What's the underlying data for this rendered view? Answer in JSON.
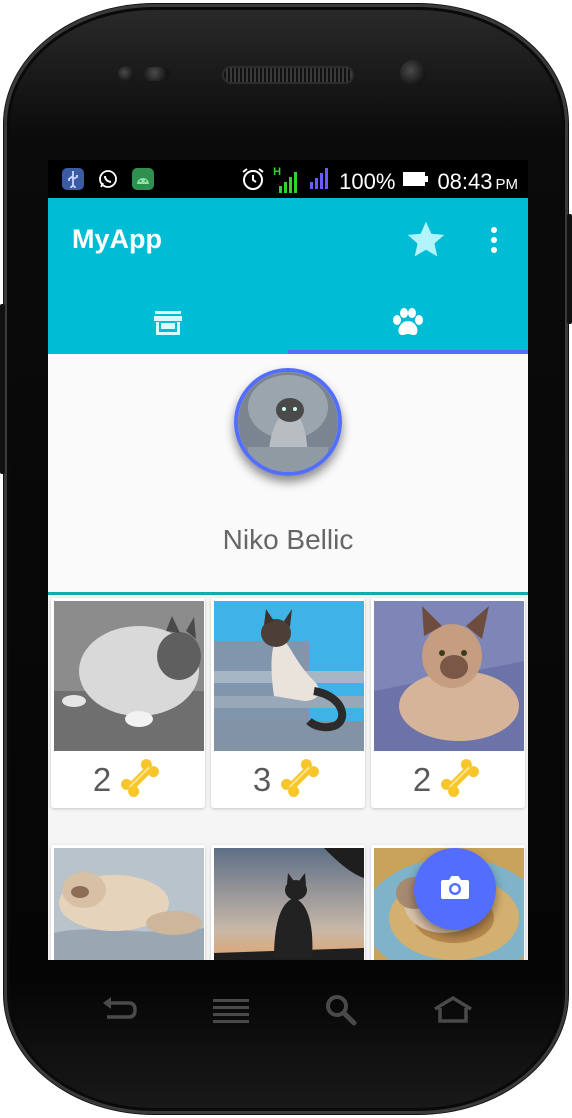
{
  "status_bar": {
    "notification_icons": [
      "usb-icon",
      "whatsapp-icon",
      "android-debug-icon"
    ],
    "network_type": "H",
    "battery_percent": "100%",
    "time": "08:43",
    "am_pm": "PM",
    "colors": {
      "usb": "#3b5ba5",
      "whatsapp": "#ffffff",
      "android": "#2f8f4f",
      "signal1": "#2fd52f",
      "signal2": "#6a5cff"
    }
  },
  "app_bar": {
    "title": "MyApp",
    "background": "#00bcd4",
    "actions": [
      "star-icon",
      "more-vert-icon"
    ],
    "star_color": "#b2f4fb"
  },
  "tabs": [
    {
      "icon": "store-icon",
      "selected": false
    },
    {
      "icon": "paw-icon",
      "selected": true
    }
  ],
  "profile": {
    "name": "Niko Bellic",
    "avatar_ring_color": "#536dfe"
  },
  "pets": [
    {
      "count": "2",
      "icon": "bone-icon",
      "photo": "gray-cat"
    },
    {
      "count": "3",
      "icon": "bone-icon",
      "photo": "siamese-cat-on-steps"
    },
    {
      "count": "2",
      "icon": "bone-icon",
      "photo": "siamese-cat-on-blanket"
    },
    {
      "count": "",
      "icon": "bone-icon",
      "photo": "cream-cat-lying"
    },
    {
      "count": "",
      "icon": "bone-icon",
      "photo": "cat-silhouette-sunset"
    },
    {
      "count": "",
      "icon": "bone-icon",
      "photo": "cat-on-rug"
    }
  ],
  "fab": {
    "icon": "camera-icon",
    "color": "#536dfe"
  },
  "hardware_keys": [
    "back-icon",
    "menu-icon",
    "search-icon",
    "home-icon"
  ]
}
